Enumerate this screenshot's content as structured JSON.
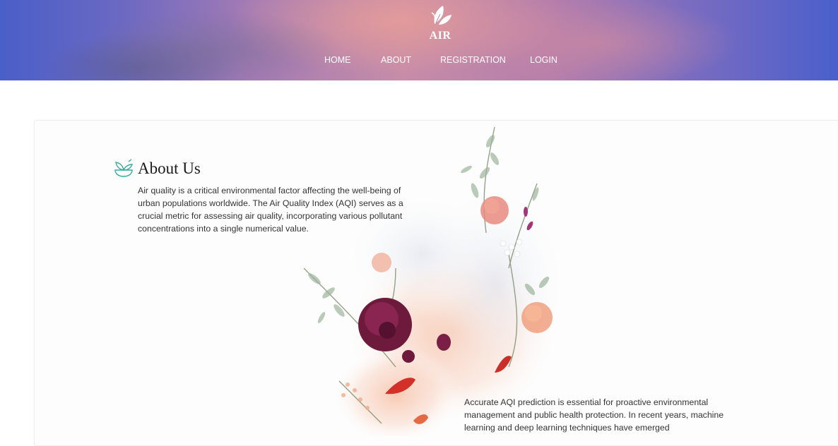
{
  "header": {
    "brand": "AIR",
    "logo_icon": "leaf-icon",
    "nav": [
      {
        "label": "HOME"
      },
      {
        "label": "ABOUT"
      },
      {
        "label": "REGISTRATION"
      },
      {
        "label": "LOGIN"
      }
    ]
  },
  "about": {
    "icon": "plant-bowl-icon",
    "title": "About Us",
    "paragraph1": "Air quality is a critical environmental factor affecting the well-being of urban populations worldwide. The Air Quality Index (AQI) serves as a crucial metric for assessing air quality, incorporating various pollutant concentrations into a single numerical value.",
    "paragraph2": "Accurate AQI prediction is essential for proactive environmental management and public health protection. In recent years, machine learning and deep learning techniques have emerged"
  },
  "colors": {
    "accent_teal": "#3aa9a0",
    "text": "#333333",
    "header_blue": "#4a5fc9",
    "header_pink": "#c78ca8"
  }
}
